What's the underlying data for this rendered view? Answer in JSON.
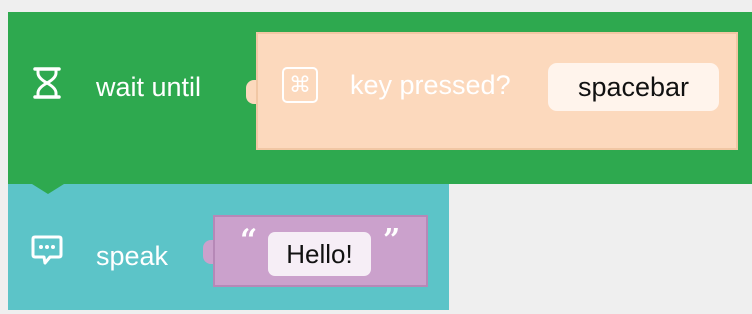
{
  "blocks": {
    "wait_until": {
      "label": "wait until",
      "icon": "hourglass-icon",
      "color": "#2ea94f"
    },
    "key_pressed": {
      "label": "key pressed?",
      "icon": "command-icon",
      "icon_glyph": "⌘",
      "selected_key": "spacebar",
      "color": "#fcd9bd"
    },
    "speak": {
      "label": "speak",
      "icon": "speech-bubble-icon",
      "color": "#5cc4c8"
    },
    "text": {
      "open_quote": "“",
      "close_quote": "”",
      "value": "Hello!",
      "color": "#cba1cc"
    }
  }
}
